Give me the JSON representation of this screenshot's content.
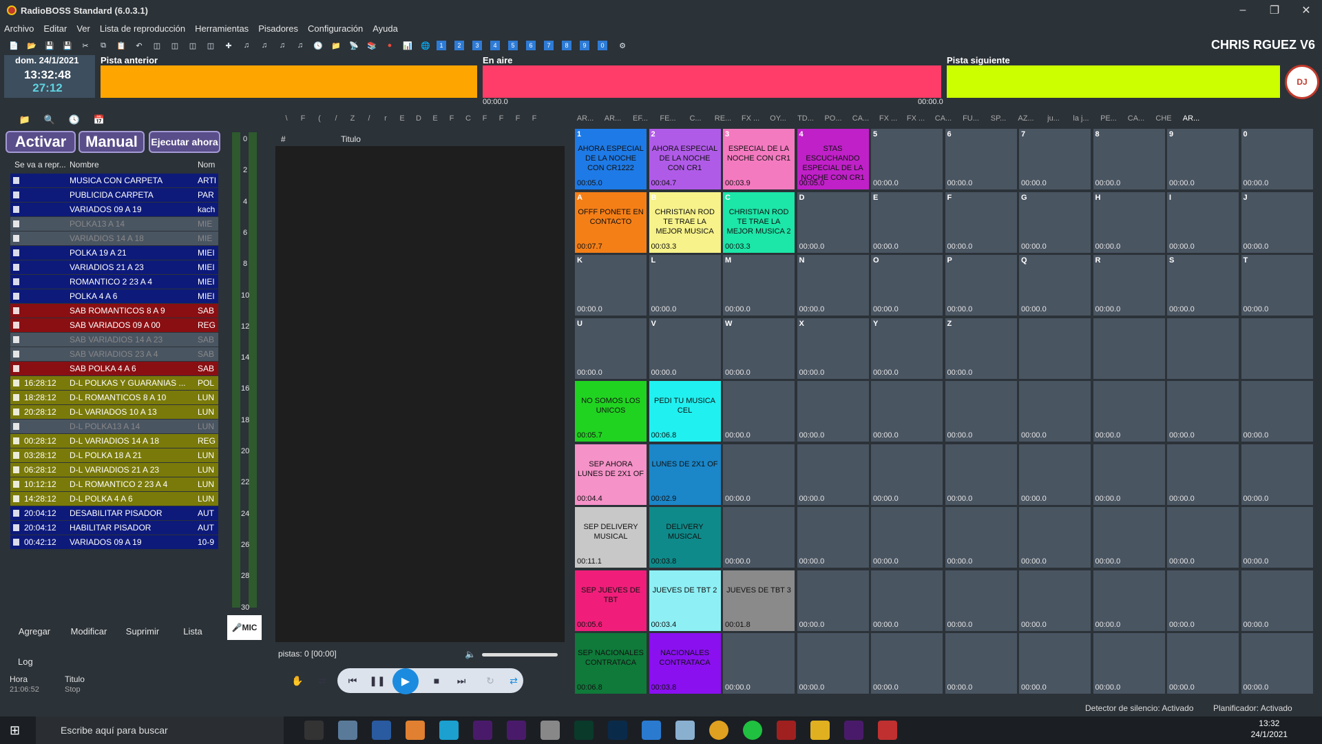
{
  "window": {
    "title": "RadioBOSS Standard (6.0.3.1)",
    "brand": "CHRIS RGUEZ V6"
  },
  "menu": [
    "Archivo",
    "Editar",
    "Ver",
    "Lista de reproducción",
    "Herramientas",
    "Pisadores",
    "Configuración",
    "Ayuda"
  ],
  "toolbar": {
    "numbers": [
      "1",
      "2",
      "3",
      "4",
      "5",
      "6",
      "7",
      "8",
      "9",
      "0"
    ]
  },
  "clock": {
    "date": "dom. 24/1/2021",
    "time": "13:32:48",
    "countdown": "27:12"
  },
  "players": {
    "prev_label": "Pista anterior",
    "onair_label": "En aire",
    "next_label": "Pista siguiente",
    "onair_start": "00:00.0",
    "onair_end": "00:00.0",
    "logo_text": "DJ"
  },
  "scheduler": {
    "activar": "Activar",
    "manual": "Manual",
    "ejecutar": "Ejecutar ahora",
    "col1": "Se va a repr...",
    "col2": "Nombre",
    "col3": "Nom",
    "rows": [
      {
        "time": "",
        "name": "MUSICA CON CARPETA",
        "extra": "ARTI",
        "color": "#0d1a7a"
      },
      {
        "time": "",
        "name": "PUBLICIDA CARPETA",
        "extra": "PAR",
        "color": "#0d1a7a"
      },
      {
        "time": "",
        "name": "VARIADOS 09 A 19",
        "extra": "kach",
        "color": "#0d1a7a"
      },
      {
        "time": "",
        "name": "POLKA13 A 14",
        "extra": "MIE",
        "color": "#4a5562"
      },
      {
        "time": "",
        "name": "VARIADIOS 14 A 18",
        "extra": "MIE",
        "color": "#4a5562"
      },
      {
        "time": "",
        "name": "POLKA 19 A 21",
        "extra": "MIEI",
        "color": "#0d1a7a"
      },
      {
        "time": "",
        "name": "VARIADIOS  21 A 23",
        "extra": "MIEI",
        "color": "#0d1a7a"
      },
      {
        "time": "",
        "name": "ROMANTICO 2 23 A 4",
        "extra": "MIEI",
        "color": "#0d1a7a"
      },
      {
        "time": "",
        "name": "POLKA  4  A 6",
        "extra": "MIEI",
        "color": "#0d1a7a"
      },
      {
        "time": "",
        "name": "SAB ROMANTICOS 8  A 9",
        "extra": "SAB",
        "color": "#8a0f12"
      },
      {
        "time": "",
        "name": "SAB VARIADOS 09 A 00",
        "extra": "REG",
        "color": "#8a0f12"
      },
      {
        "time": "",
        "name": "SAB VARIADIOS 14 A 23",
        "extra": "SAB",
        "color": "#4a5562"
      },
      {
        "time": "",
        "name": "SAB VARIADIOS 23 A 4",
        "extra": "SAB",
        "color": "#4a5562"
      },
      {
        "time": "",
        "name": "SAB POLKA  4  A 6",
        "extra": "SAB",
        "color": "#8a0f12"
      },
      {
        "time": "16:28:12",
        "name": "D-L  POLKAS Y GUARANIAS ...",
        "extra": "POL",
        "color": "#7a7a0a"
      },
      {
        "time": "18:28:12",
        "name": "D-L ROMANTICOS 8 A 10",
        "extra": "LUN",
        "color": "#7a7a0a"
      },
      {
        "time": "20:28:12",
        "name": "D-L VARIADOS 10 A 13",
        "extra": "LUN",
        "color": "#7a7a0a"
      },
      {
        "time": "",
        "name": "D-L POLKA13 A 14",
        "extra": "LUN",
        "color": "#4a5562"
      },
      {
        "time": "00:28:12",
        "name": "D-L VARIADIOS 14 A 18",
        "extra": "REG",
        "color": "#7a7a0a"
      },
      {
        "time": "03:28:12",
        "name": "D-L POLKA 18 A 21",
        "extra": "LUN",
        "color": "#7a7a0a"
      },
      {
        "time": "06:28:12",
        "name": "D-L VARIADIOS  21 A 23",
        "extra": "LUN",
        "color": "#7a7a0a"
      },
      {
        "time": "10:12:12",
        "name": "D-L ROMANTICO 2 23 A 4",
        "extra": "LUN",
        "color": "#7a7a0a"
      },
      {
        "time": "14:28:12",
        "name": "D-L POLKA  4  A 6",
        "extra": "LUN",
        "color": "#7a7a0a"
      },
      {
        "time": "20:04:12",
        "name": "DESABILITAR PISADOR",
        "extra": "AUT",
        "color": "#0d1a7a"
      },
      {
        "time": "20:04:12",
        "name": "HABILITAR PISADOR",
        "extra": "AUT",
        "color": "#0d1a7a"
      },
      {
        "time": "00:42:12",
        "name": "VARIADOS 09 A 19",
        "extra": "10-9",
        "color": "#0d1a7a"
      }
    ],
    "buttons": [
      "Agregar",
      "Modificar",
      "Suprimir",
      "Lista"
    ]
  },
  "meter": {
    "scale": [
      "0",
      "2",
      "4",
      "6",
      "8",
      "10",
      "12",
      "14",
      "16",
      "18",
      "20",
      "22",
      "24",
      "26",
      "28",
      "30"
    ],
    "mic": "MIC"
  },
  "log": {
    "tab": "Log",
    "col1": "Hora",
    "col2": "Titulo",
    "row_time": "21:06:52",
    "row_title": "Stop"
  },
  "playlist": {
    "col1": "#",
    "col2": "Titulo",
    "status": "pistas: 0 [00:00]"
  },
  "cartwall": {
    "tabs": [
      "AR...",
      "AR...",
      "EF...",
      "FE...",
      "C...",
      "RE...",
      "FX ...",
      "OY...",
      "TD...",
      "PO...",
      "CA...",
      "FX ...",
      "FX ...",
      "CA...",
      "FU...",
      "SP...",
      "AZ...",
      "ju...",
      "la j...",
      "PE...",
      "CA...",
      "CHE",
      "AR..."
    ],
    "cells": [
      {
        "k": "1",
        "t": "AHORA ESPECIAL DE LA NOCHE CON CR1222",
        "d": "00:05.0",
        "c": "#1e7ae6"
      },
      {
        "k": "2",
        "t": "AHORA ESPECIAL DE LA NOCHE CON CR1",
        "d": "00:04.7",
        "c": "#b05be8"
      },
      {
        "k": "3",
        "t": "ESPECIAL DE LA NOCHE CON CR1",
        "d": "00:03.9",
        "c": "#f47ac0"
      },
      {
        "k": "4",
        "t": "STAS ESCUCHANDO ESPECIAL DE LA NOCHE CON CR1",
        "d": "00:05.0",
        "c": "#c020c8"
      },
      {
        "k": "5",
        "t": "",
        "d": "00:00.0",
        "c": ""
      },
      {
        "k": "6",
        "t": "",
        "d": "00:00.0",
        "c": ""
      },
      {
        "k": "7",
        "t": "",
        "d": "00:00.0",
        "c": ""
      },
      {
        "k": "8",
        "t": "",
        "d": "00:00.0",
        "c": ""
      },
      {
        "k": "9",
        "t": "",
        "d": "00:00.0",
        "c": ""
      },
      {
        "k": "0",
        "t": "",
        "d": "00:00.0",
        "c": ""
      },
      {
        "k": "A",
        "t": "OFFF PONETE EN CONTACTO",
        "d": "00:07.7",
        "c": "#f57f17"
      },
      {
        "k": "B",
        "t": "CHRISTIAN ROD TE TRAE LA MEJOR MUSICA",
        "d": "00:03.3",
        "c": "#f7f28a"
      },
      {
        "k": "C",
        "t": "CHRISTIAN ROD TE TRAE LA MEJOR MUSICA 2",
        "d": "00:03.3",
        "c": "#1ce6a8"
      },
      {
        "k": "D",
        "t": "",
        "d": "00:00.0",
        "c": ""
      },
      {
        "k": "E",
        "t": "",
        "d": "00:00.0",
        "c": ""
      },
      {
        "k": "F",
        "t": "",
        "d": "00:00.0",
        "c": ""
      },
      {
        "k": "G",
        "t": "",
        "d": "00:00.0",
        "c": ""
      },
      {
        "k": "H",
        "t": "",
        "d": "00:00.0",
        "c": ""
      },
      {
        "k": "I",
        "t": "",
        "d": "00:00.0",
        "c": ""
      },
      {
        "k": "J",
        "t": "",
        "d": "00:00.0",
        "c": ""
      },
      {
        "k": "K",
        "t": "",
        "d": "00:00.0",
        "c": ""
      },
      {
        "k": "L",
        "t": "",
        "d": "00:00.0",
        "c": ""
      },
      {
        "k": "M",
        "t": "",
        "d": "00:00.0",
        "c": ""
      },
      {
        "k": "N",
        "t": "",
        "d": "00:00.0",
        "c": ""
      },
      {
        "k": "O",
        "t": "",
        "d": "00:00.0",
        "c": ""
      },
      {
        "k": "P",
        "t": "",
        "d": "00:00.0",
        "c": ""
      },
      {
        "k": "Q",
        "t": "",
        "d": "00:00.0",
        "c": ""
      },
      {
        "k": "R",
        "t": "",
        "d": "00:00.0",
        "c": ""
      },
      {
        "k": "S",
        "t": "",
        "d": "00:00.0",
        "c": ""
      },
      {
        "k": "T",
        "t": "",
        "d": "00:00.0",
        "c": ""
      },
      {
        "k": "U",
        "t": "",
        "d": "00:00.0",
        "c": ""
      },
      {
        "k": "V",
        "t": "",
        "d": "00:00.0",
        "c": ""
      },
      {
        "k": "W",
        "t": "",
        "d": "00:00.0",
        "c": ""
      },
      {
        "k": "X",
        "t": "",
        "d": "00:00.0",
        "c": ""
      },
      {
        "k": "Y",
        "t": "",
        "d": "00:00.0",
        "c": ""
      },
      {
        "k": "Z",
        "t": "",
        "d": "00:00.0",
        "c": ""
      },
      {
        "k": "",
        "t": "",
        "d": "",
        "c": ""
      },
      {
        "k": "",
        "t": "",
        "d": "",
        "c": ""
      },
      {
        "k": "",
        "t": "",
        "d": "",
        "c": ""
      },
      {
        "k": "",
        "t": "",
        "d": "",
        "c": ""
      },
      {
        "k": "",
        "t": "NO SOMOS LOS UNICOS",
        "d": "00:05.7",
        "c": "#21d321"
      },
      {
        "k": "",
        "t": "PEDI TU MUSICA CEL",
        "d": "00:06.8",
        "c": "#21f0f0"
      },
      {
        "k": "",
        "t": "",
        "d": "00:00.0",
        "c": ""
      },
      {
        "k": "",
        "t": "",
        "d": "00:00.0",
        "c": ""
      },
      {
        "k": "",
        "t": "",
        "d": "00:00.0",
        "c": ""
      },
      {
        "k": "",
        "t": "",
        "d": "00:00.0",
        "c": ""
      },
      {
        "k": "",
        "t": "",
        "d": "00:00.0",
        "c": ""
      },
      {
        "k": "",
        "t": "",
        "d": "00:00.0",
        "c": ""
      },
      {
        "k": "",
        "t": "",
        "d": "00:00.0",
        "c": ""
      },
      {
        "k": "",
        "t": "",
        "d": "00:00.0",
        "c": ""
      },
      {
        "k": "",
        "t": "SEP AHORA LUNES DE 2X1 OF",
        "d": "00:04.4",
        "c": "#f592c8"
      },
      {
        "k": "",
        "t": "LUNES DE 2X1 OF",
        "d": "00:02.9",
        "c": "#1b86c8"
      },
      {
        "k": "",
        "t": "",
        "d": "00:00.0",
        "c": ""
      },
      {
        "k": "",
        "t": "",
        "d": "00:00.0",
        "c": ""
      },
      {
        "k": "",
        "t": "",
        "d": "00:00.0",
        "c": ""
      },
      {
        "k": "",
        "t": "",
        "d": "00:00.0",
        "c": ""
      },
      {
        "k": "",
        "t": "",
        "d": "00:00.0",
        "c": ""
      },
      {
        "k": "",
        "t": "",
        "d": "00:00.0",
        "c": ""
      },
      {
        "k": "",
        "t": "",
        "d": "00:00.0",
        "c": ""
      },
      {
        "k": "",
        "t": "",
        "d": "00:00.0",
        "c": ""
      },
      {
        "k": "",
        "t": "SEP DELIVERY MUSICAL",
        "d": "00:11.1",
        "c": "#c8c8c8"
      },
      {
        "k": "",
        "t": "DELIVERY MUSICAL",
        "d": "00:03.8",
        "c": "#0f8a8a"
      },
      {
        "k": "",
        "t": "",
        "d": "00:00.0",
        "c": ""
      },
      {
        "k": "",
        "t": "",
        "d": "00:00.0",
        "c": ""
      },
      {
        "k": "",
        "t": "",
        "d": "00:00.0",
        "c": ""
      },
      {
        "k": "",
        "t": "",
        "d": "00:00.0",
        "c": ""
      },
      {
        "k": "",
        "t": "",
        "d": "00:00.0",
        "c": ""
      },
      {
        "k": "",
        "t": "",
        "d": "00:00.0",
        "c": ""
      },
      {
        "k": "",
        "t": "",
        "d": "00:00.0",
        "c": ""
      },
      {
        "k": "",
        "t": "",
        "d": "00:00.0",
        "c": ""
      },
      {
        "k": "",
        "t": "SEP JUEVES DE TBT",
        "d": "00:05.6",
        "c": "#f01e7a"
      },
      {
        "k": "",
        "t": "JUEVES DE TBT 2",
        "d": "00:03.4",
        "c": "#8ef0f5"
      },
      {
        "k": "",
        "t": "JUEVES DE TBT 3",
        "d": "00:01.8",
        "c": "#8a8a8a"
      },
      {
        "k": "",
        "t": "",
        "d": "00:00.0",
        "c": ""
      },
      {
        "k": "",
        "t": "",
        "d": "00:00.0",
        "c": ""
      },
      {
        "k": "",
        "t": "",
        "d": "00:00.0",
        "c": ""
      },
      {
        "k": "",
        "t": "",
        "d": "00:00.0",
        "c": ""
      },
      {
        "k": "",
        "t": "",
        "d": "00:00.0",
        "c": ""
      },
      {
        "k": "",
        "t": "",
        "d": "00:00.0",
        "c": ""
      },
      {
        "k": "",
        "t": "",
        "d": "00:00.0",
        "c": ""
      },
      {
        "k": "",
        "t": "SEP NACIONALES CONTRATACA",
        "d": "00:06.8",
        "c": "#0f7a3a"
      },
      {
        "k": "",
        "t": "NACIONALES CONTRATACA",
        "d": "00:03.8",
        "c": "#8a10f0"
      },
      {
        "k": "",
        "t": "",
        "d": "00:00.0",
        "c": ""
      },
      {
        "k": "",
        "t": "",
        "d": "00:00.0",
        "c": ""
      },
      {
        "k": "",
        "t": "",
        "d": "00:00.0",
        "c": ""
      },
      {
        "k": "",
        "t": "",
        "d": "00:00.0",
        "c": ""
      },
      {
        "k": "",
        "t": "",
        "d": "00:00.0",
        "c": ""
      },
      {
        "k": "",
        "t": "",
        "d": "00:00.0",
        "c": ""
      },
      {
        "k": "",
        "t": "",
        "d": "00:00.0",
        "c": ""
      },
      {
        "k": "",
        "t": "",
        "d": "00:00.0",
        "c": ""
      }
    ]
  },
  "status": {
    "silence": "Detector de silencio: Activado",
    "scheduler": "Planificador: Activado"
  },
  "taskbar": {
    "search": "Escribe aquí para buscar",
    "time": "13:32",
    "date": "24/1/2021"
  }
}
